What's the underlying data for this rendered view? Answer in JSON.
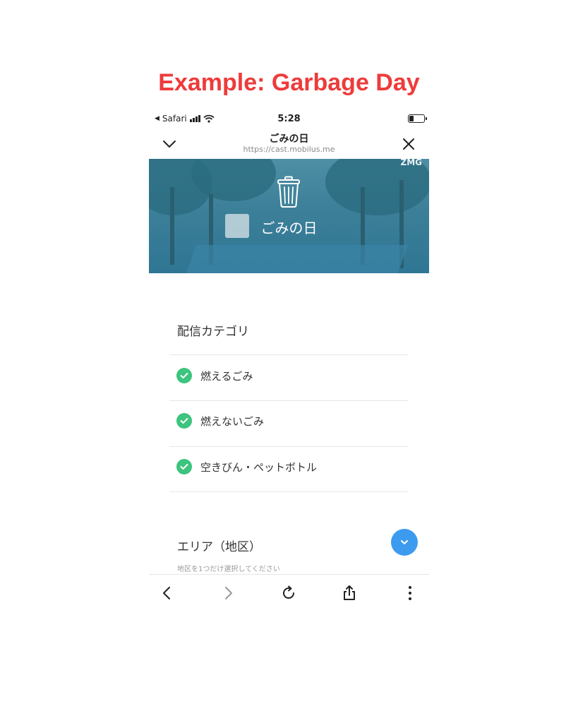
{
  "caption": "Example: Garbage Day",
  "status_bar": {
    "back_app": "Safari",
    "time": "5:28"
  },
  "browser": {
    "page_title": "ごみの日",
    "url": "https://cast.mobilus.me"
  },
  "hero": {
    "title": "ごみの日",
    "logo_text": "ZMG"
  },
  "categories": {
    "heading": "配信カテゴリ",
    "items": [
      {
        "label": "燃えるごみ",
        "checked": true
      },
      {
        "label": "燃えないごみ",
        "checked": true
      },
      {
        "label": "空きびん・ペットボトル",
        "checked": true
      }
    ]
  },
  "area": {
    "heading": "エリア（地区）",
    "hint": "地区を1つだけ選択してください"
  },
  "colors": {
    "caption": "#ee3b3b",
    "check": "#3dc47e",
    "fab": "#3d9bef",
    "hero_tint": "#3c7f98"
  },
  "icons": {
    "collapse": "chevron-down-icon",
    "close": "close-icon",
    "trash": "trash-can-icon",
    "check": "check-circle-icon",
    "fab": "chevron-down-icon",
    "back": "chevron-left-icon",
    "forward": "chevron-right-icon",
    "reload": "reload-icon",
    "share": "share-icon",
    "more": "more-vertical-icon"
  }
}
